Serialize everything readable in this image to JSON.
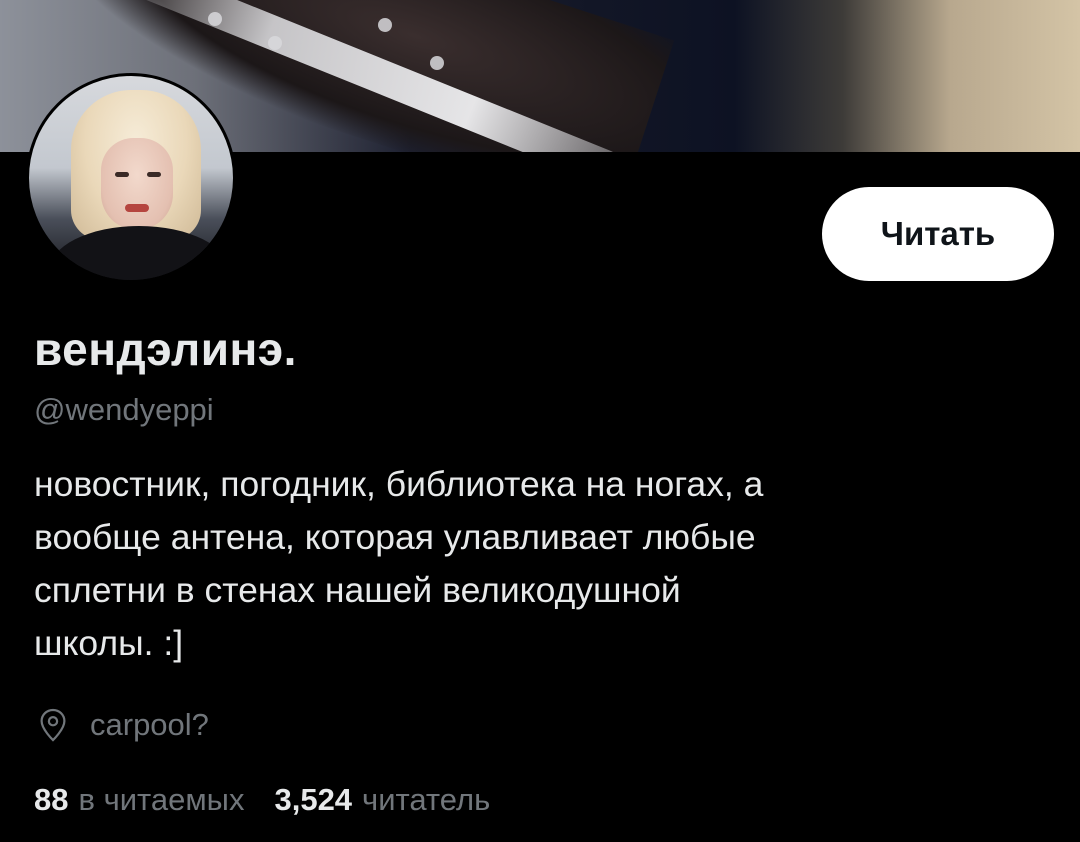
{
  "profile": {
    "follow_label": "Читать",
    "display_name": "вендэлинэ.",
    "handle": "@wendyeppi",
    "bio_lines": [
      "новостник, погодник, библиотека на ногах, а",
      "вообще антена, которая улавливает любые",
      "сплетни в стенах нашей великодушной",
      "школы. :]"
    ],
    "location": "carpool?",
    "following_count": "88",
    "following_label": "в читаемых",
    "followers_count": "3,524",
    "followers_label": "читатель"
  },
  "icons": {
    "location": "location-pin-icon"
  },
  "colors": {
    "background": "#000000",
    "primary_text": "#e7e9ea",
    "secondary_text": "#71767b",
    "button_bg": "#ffffff",
    "button_text": "#0f1419"
  }
}
